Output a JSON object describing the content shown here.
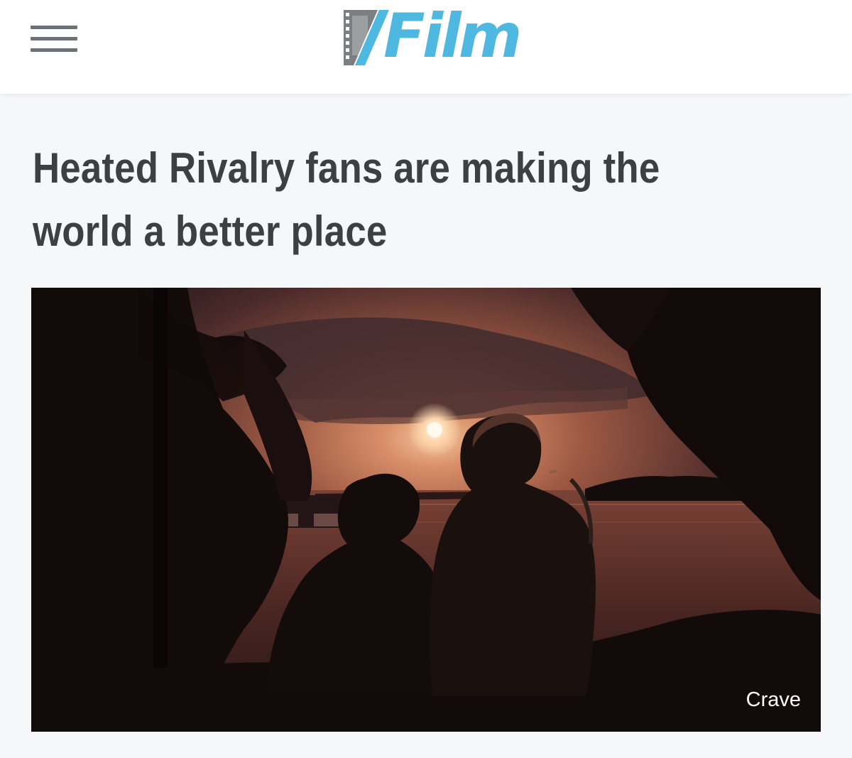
{
  "header": {
    "menu_icon": "hamburger-menu-icon",
    "logo_text": "Film",
    "logo_mark_icon": "film-strip-slash-icon",
    "logo_color": "#4fb8e0",
    "logo_mark_color": "#7b7f82"
  },
  "article": {
    "headline_line1": "Heated Rivalry fans are making the",
    "headline_line2": "world a better place",
    "image_credit": "Crave",
    "image_subject": "two-people-silhouette-at-sunset-lake"
  }
}
